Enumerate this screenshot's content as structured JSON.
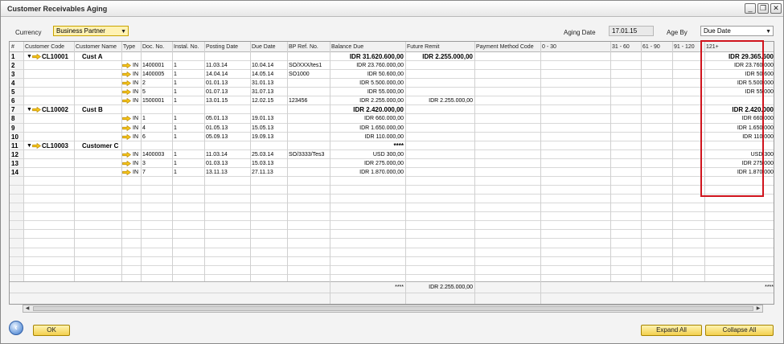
{
  "window": {
    "title": "Customer Receivables Aging",
    "min_icon": "minimize-icon",
    "restore_icon": "restore-icon",
    "close_icon": "close-icon"
  },
  "filters": {
    "currency_label": "Currency",
    "currency_value": "Business Partner",
    "aging_date_label": "Aging Date",
    "aging_date_value": "17.01.15",
    "age_by_label": "Age By",
    "age_by_value": "Due Date"
  },
  "columns": [
    "#",
    "Customer Code",
    "Customer Name",
    "Type",
    "Doc. No.",
    "Instal. No.",
    "Posting Date",
    "Due Date",
    "BP Ref. No.",
    "Balance Due",
    "Future Remit",
    "Payment Method Code",
    "0 - 30",
    "31 - 60",
    "61 - 90",
    "91 - 120",
    "121+"
  ],
  "rows": [
    {
      "n": "1",
      "kind": "group",
      "code": "CL10001",
      "name": "Cust A",
      "balance": "IDR  31.620.600,00",
      "future": "IDR  2.255.000,00",
      "c121": "IDR  29.365.600"
    },
    {
      "n": "2",
      "kind": "doc",
      "type": "IN",
      "doc": "1400001",
      "inst": "1",
      "post": "11.03.14",
      "due": "10.04.14",
      "ref": "SO/XXX/tes1",
      "balance": "IDR  23.760.000,00",
      "future": "",
      "c121": "IDR  23.760.000"
    },
    {
      "n": "3",
      "kind": "doc",
      "type": "IN",
      "doc": "1400005",
      "inst": "1",
      "post": "14.04.14",
      "due": "14.05.14",
      "ref": "SO1000",
      "balance": "IDR  50.600,00",
      "future": "",
      "c121": "IDR  50.600"
    },
    {
      "n": "4",
      "kind": "doc",
      "type": "IN",
      "doc": "2",
      "inst": "1",
      "post": "01.01.13",
      "due": "31.01.13",
      "ref": "",
      "balance": "IDR  5.500.000,00",
      "future": "",
      "c121": "IDR  5.500.000"
    },
    {
      "n": "5",
      "kind": "doc",
      "type": "IN",
      "doc": "5",
      "inst": "1",
      "post": "01.07.13",
      "due": "31.07.13",
      "ref": "",
      "balance": "IDR  55.000,00",
      "future": "",
      "c121": "IDR  55.000"
    },
    {
      "n": "6",
      "kind": "doc",
      "type": "IN",
      "doc": "1500001",
      "inst": "1",
      "post": "13.01.15",
      "due": "12.02.15",
      "ref": "123456",
      "balance": "IDR  2.255.000,00",
      "future": "IDR  2.255.000,00",
      "c121": ""
    },
    {
      "n": "7",
      "kind": "group",
      "code": "CL10002",
      "name": "Cust B",
      "balance": "IDR  2.420.000,00",
      "future": "",
      "c121": "IDR  2.420.000"
    },
    {
      "n": "8",
      "kind": "doc",
      "type": "IN",
      "doc": "1",
      "inst": "1",
      "post": "05.01.13",
      "due": "19.01.13",
      "ref": "",
      "balance": "IDR  660.000,00",
      "future": "",
      "c121": "IDR  660.000"
    },
    {
      "n": "9",
      "kind": "doc",
      "type": "IN",
      "doc": "4",
      "inst": "1",
      "post": "01.05.13",
      "due": "15.05.13",
      "ref": "",
      "balance": "IDR  1.650.000,00",
      "future": "",
      "c121": "IDR  1.650.000"
    },
    {
      "n": "10",
      "kind": "doc",
      "type": "IN",
      "doc": "6",
      "inst": "1",
      "post": "05.09.13",
      "due": "19.09.13",
      "ref": "",
      "balance": "IDR  110.000,00",
      "future": "",
      "c121": "IDR  110.000"
    },
    {
      "n": "11",
      "kind": "group",
      "code": "CL10003",
      "name": "Customer C",
      "balance": "****",
      "future": "",
      "c121": ""
    },
    {
      "n": "12",
      "kind": "doc",
      "type": "IN",
      "doc": "1400003",
      "inst": "1",
      "post": "11.03.14",
      "due": "25.03.14",
      "ref": "SO/3333/Tes3",
      "balance": "USD  300,00",
      "future": "",
      "c121": "USD  300"
    },
    {
      "n": "13",
      "kind": "doc",
      "type": "IN",
      "doc": "3",
      "inst": "1",
      "post": "01.03.13",
      "due": "15.03.13",
      "ref": "",
      "balance": "IDR  275.000,00",
      "future": "",
      "c121": "IDR  275.000"
    },
    {
      "n": "14",
      "kind": "doc",
      "type": "IN",
      "doc": "7",
      "inst": "1",
      "post": "13.11.13",
      "due": "27.11.13",
      "ref": "",
      "balance": "IDR  1.870.000,00",
      "future": "",
      "c121": "IDR  1.870.000"
    }
  ],
  "totals": {
    "balance": "****",
    "future": "IDR  2.255.000,00",
    "c121": "****"
  },
  "buttons": {
    "ok": "OK",
    "expand_all": "Expand All",
    "collapse_all": "Collapse All"
  }
}
